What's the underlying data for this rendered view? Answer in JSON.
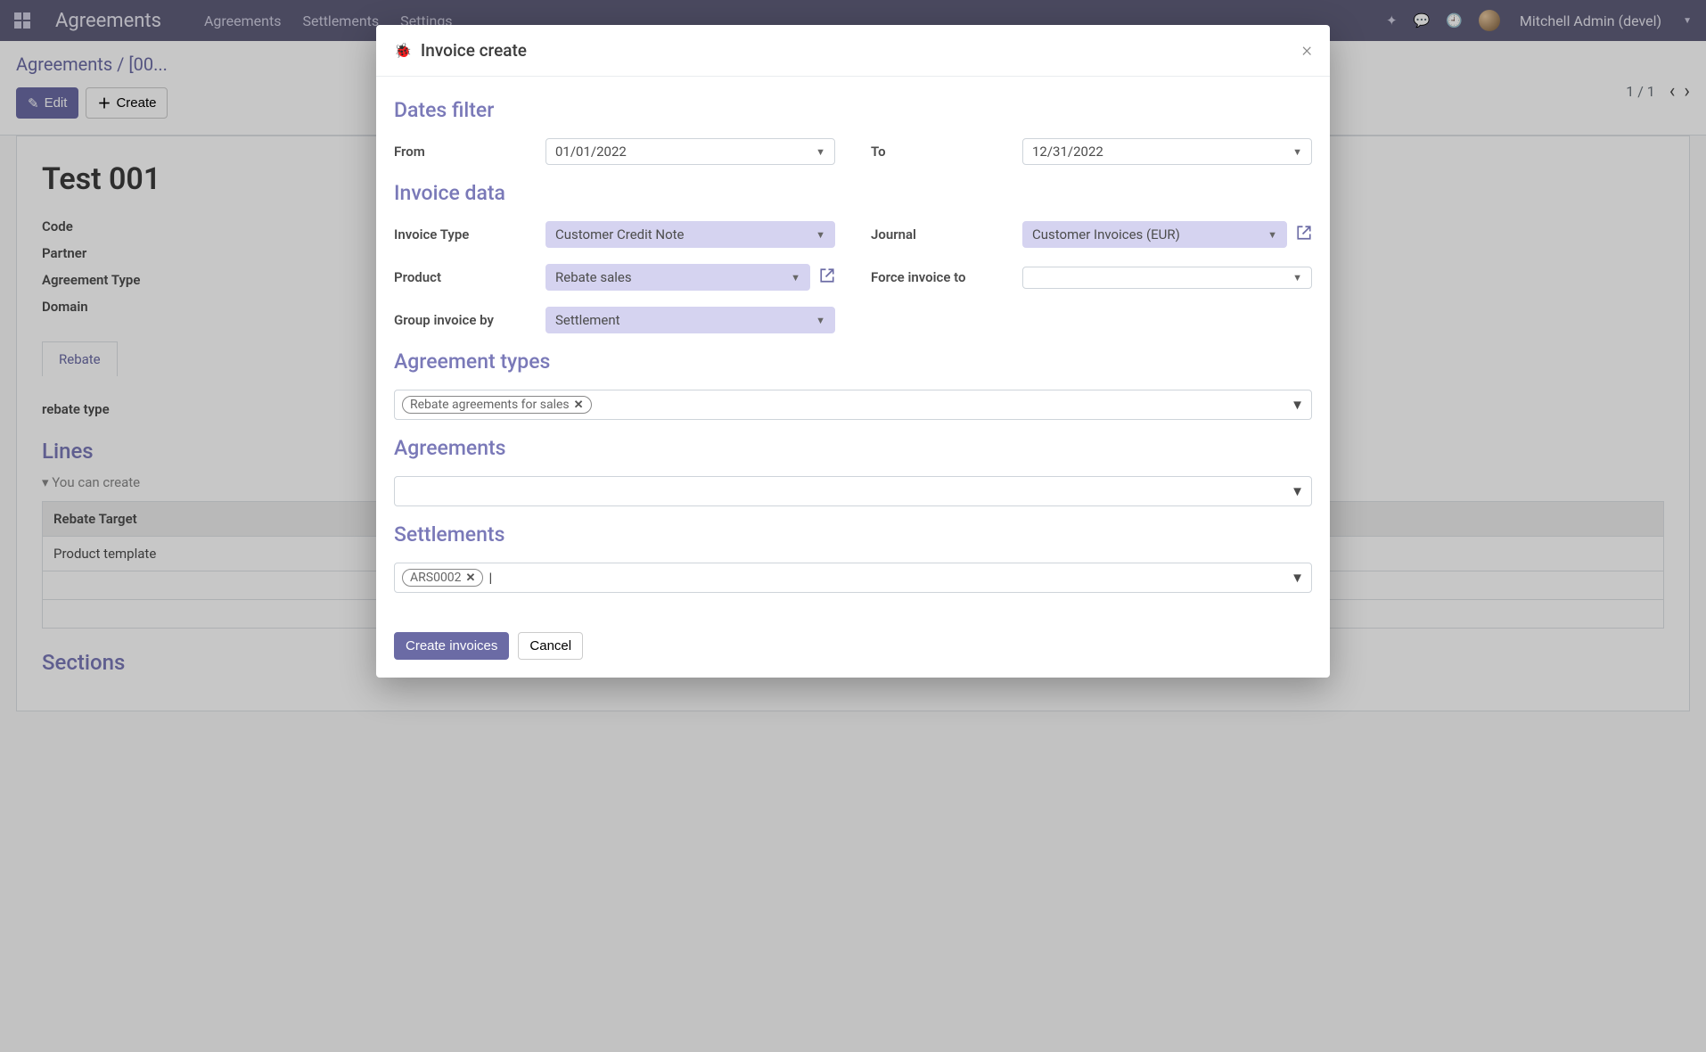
{
  "navbar": {
    "app_title": "Agreements",
    "links": [
      "Agreements",
      "Settlements",
      "Settings"
    ],
    "user": "Mitchell Admin (devel)"
  },
  "breadcrumb": {
    "root": "Agreements",
    "current": "[00..."
  },
  "buttons": {
    "edit": "Edit",
    "create": "Create"
  },
  "pager": {
    "text": "1 / 1"
  },
  "record": {
    "title": "Test 001",
    "labels": {
      "code": "Code",
      "partner": "Partner",
      "agreement_type": "Agreement Type",
      "domain": "Domain"
    },
    "tab": "Rebate",
    "rebate_type_label": "rebate type",
    "lines_title": "Lines",
    "lines_hint": "You can create",
    "table_header": "Rebate Target",
    "table_row0": "Product template",
    "sections_title": "Sections"
  },
  "modal": {
    "title": "Invoice create",
    "sections": {
      "dates": "Dates filter",
      "invoice": "Invoice data",
      "agreement_types": "Agreement types",
      "agreements": "Agreements",
      "settlements": "Settlements"
    },
    "labels": {
      "from": "From",
      "to": "To",
      "invoice_type": "Invoice Type",
      "journal": "Journal",
      "product": "Product",
      "force_invoice_to": "Force invoice to",
      "group_invoice_by": "Group invoice by"
    },
    "values": {
      "from": "01/01/2022",
      "to": "12/31/2022",
      "invoice_type": "Customer Credit Note",
      "journal": "Customer Invoices (EUR)",
      "product": "Rebate sales",
      "force_invoice_to": "",
      "group_invoice_by": "Settlement"
    },
    "tags": {
      "agreement_types": [
        "Rebate agreements for sales"
      ],
      "agreements": [],
      "settlements": [
        "ARS0002"
      ]
    },
    "footer": {
      "create": "Create invoices",
      "cancel": "Cancel"
    }
  }
}
